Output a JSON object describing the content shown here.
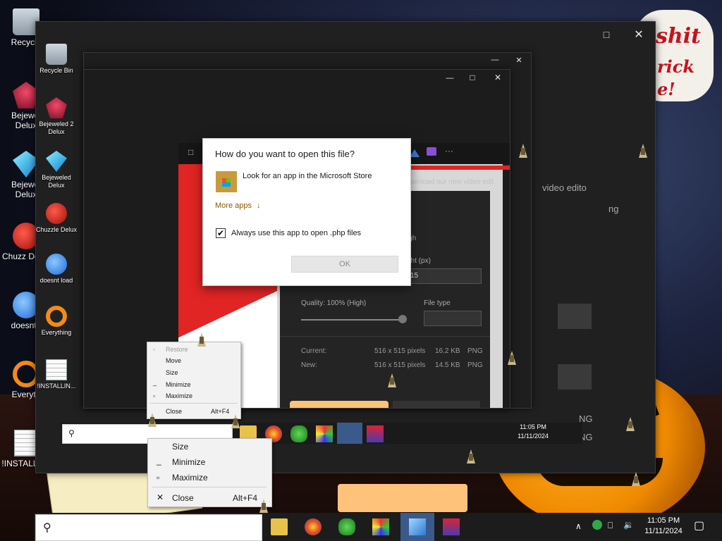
{
  "colors": {
    "accent_red": "#e12424",
    "dialog_link": "#8a5a00",
    "taskbar": "#1c1c1c",
    "orange_button": "#ffc27a"
  },
  "wallpaper": {
    "cloud_main": "shit",
    "cloud_line2": "rick",
    "cloud_line3": "e!",
    "cloud_small_1": "shit",
    "cloud_small_2": "rick",
    "cloud_small_3": "e!"
  },
  "desktop_icons": [
    {
      "label": "Recycle",
      "icon": "recycle-bin-icon"
    },
    {
      "label": "Bejewel Delux",
      "icon": "bejeweled2-icon"
    },
    {
      "label": "Bejewel Delux",
      "icon": "bejeweled-icon"
    },
    {
      "label": "Chuzz Delux",
      "icon": "chuzzle-icon"
    },
    {
      "label": "doesnt I",
      "icon": "doesnt-icon"
    },
    {
      "label": "Everyth",
      "icon": "everything-icon"
    },
    {
      "label": "!INSTALLIN...",
      "icon": "document-icon"
    },
    {
      "label": "!!",
      "icon": "document-icon"
    }
  ],
  "desktop_icons_ghost": [
    {
      "label": "Recycle Bin"
    },
    {
      "label": "Bejeweled 2 Delux"
    },
    {
      "label": "Bejeweled Delux"
    },
    {
      "label": "Chuzzle Delux"
    },
    {
      "label": "doesnt load"
    },
    {
      "label": "Everything"
    },
    {
      "label": "!INSTALLIN..."
    },
    {
      "label": "!!"
    }
  ],
  "background_window": {
    "header_fragment_1": "ownload our new video edit",
    "header_fragment_2": "video edito",
    "header_fragment_3": "ng",
    "header_fragment_4": "ght (px)",
    "header_fragment_5": "igh",
    "height_value": "15",
    "quality_label": "Quality: 100% (High)",
    "file_type_label": "File type",
    "current_label": "Current:",
    "current_size": "516 x 515 pixels",
    "current_kb": "16.2 KB",
    "current_format": "PNG",
    "new_label": "New:",
    "new_size": "516 x 515 pixels",
    "new_kb": "14.5 KB",
    "new_format": "PNG",
    "png_1": "NG",
    "png_2": "NG",
    "more_dots": "···",
    "dots_2": "· ·",
    "toolbar_glyph": "□"
  },
  "dialog": {
    "title": "How do you want to open this file?",
    "store_option": "Look for an app in the Microsoft Store",
    "more_apps": "More apps",
    "more_apps_arrow": "↓",
    "always_use": "Always use this app to open .php files",
    "checked_mark": "✔",
    "ok": "OK"
  },
  "context_menu_small": {
    "items": [
      "Restore",
      "Move",
      "Size",
      "Minimize",
      "Maximize",
      "Close"
    ],
    "close_shortcut": "Alt+F4"
  },
  "context_menu_large": {
    "items": [
      "Size",
      "Minimize",
      "Maximize",
      "Close"
    ],
    "close_shortcut": "Alt+F4"
  },
  "title_buttons": {
    "minimize": "—",
    "maximize": "□",
    "close": "✕"
  },
  "taskbar": {
    "time": "11:05 PM",
    "date": "11/11/2024",
    "chevron": "∧",
    "speaker": "🔉",
    "network": "⎕",
    "notification": "▢"
  },
  "taskbar_ghost": {
    "time": "11:05 PM",
    "date": "11/11/2024"
  }
}
